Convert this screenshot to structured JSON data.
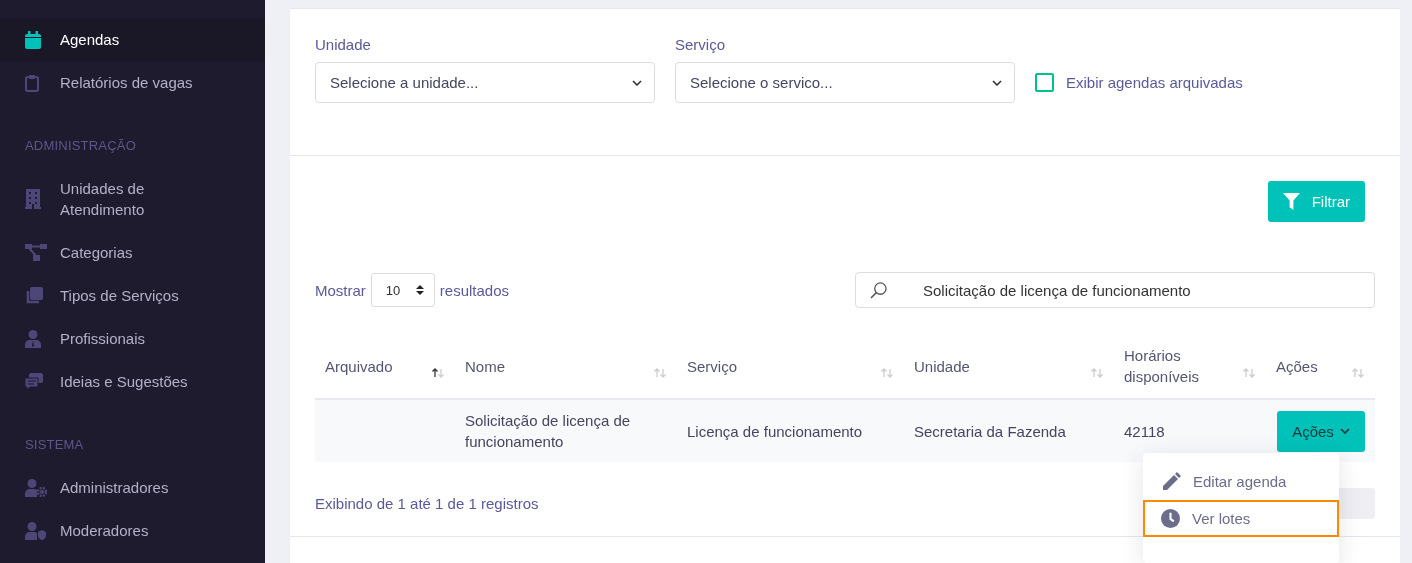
{
  "sidebar": {
    "sections": [
      {
        "items": [
          {
            "label": "Agendas",
            "selected": true
          },
          {
            "label": "Relatórios de vagas",
            "selected": false
          }
        ]
      },
      {
        "title": "ADMINISTRAÇÃO",
        "items": [
          {
            "label": "Unidades de Atendimento",
            "selected": false
          },
          {
            "label": "Categorias",
            "selected": false
          },
          {
            "label": "Tipos de Serviços",
            "selected": false
          },
          {
            "label": "Profissionais",
            "selected": false
          },
          {
            "label": "Ideias e Sugestões",
            "selected": false
          }
        ]
      },
      {
        "title": "SISTEMA",
        "items": [
          {
            "label": "Administradores",
            "selected": false
          },
          {
            "label": "Moderadores",
            "selected": false
          }
        ]
      }
    ]
  },
  "filters": {
    "unidade": {
      "label": "Unidade",
      "placeholder": "Selecione a unidade..."
    },
    "servico": {
      "label": "Serviço",
      "placeholder": "Selecione o servico..."
    },
    "archived": {
      "label": "Exibir agendas arquivadas",
      "checked": false
    },
    "filter_button": "Filtrar"
  },
  "table": {
    "length_prefix": "Mostrar",
    "length_value": "10",
    "length_suffix": "resultados",
    "search_value": "Solicitação de licença de funcionamento",
    "columns": [
      {
        "label": "Arquivado",
        "sorted_ascending": true
      },
      {
        "label": "Nome",
        "sorted_ascending": false
      },
      {
        "label": "Serviço",
        "sorted_ascending": false
      },
      {
        "label": "Unidade",
        "sorted_ascending": false
      },
      {
        "label": "Horários disponíveis",
        "sorted_ascending": false
      },
      {
        "label": "Ações",
        "sorted_ascending": false
      }
    ],
    "rows": [
      {
        "nome": "Solicitação de licença de funcionamento",
        "servico": "Licença de funcionamento",
        "unidade": "Secretaria da Fazenda",
        "horarios": "42118",
        "actions_button": "Ações"
      }
    ],
    "info": "Exibindo de 1 até 1 de 1 registros"
  },
  "actions_menu": {
    "items": [
      {
        "label": "Editar agenda",
        "focused": false
      },
      {
        "label": "Ver lotes",
        "focused": true
      }
    ]
  }
}
